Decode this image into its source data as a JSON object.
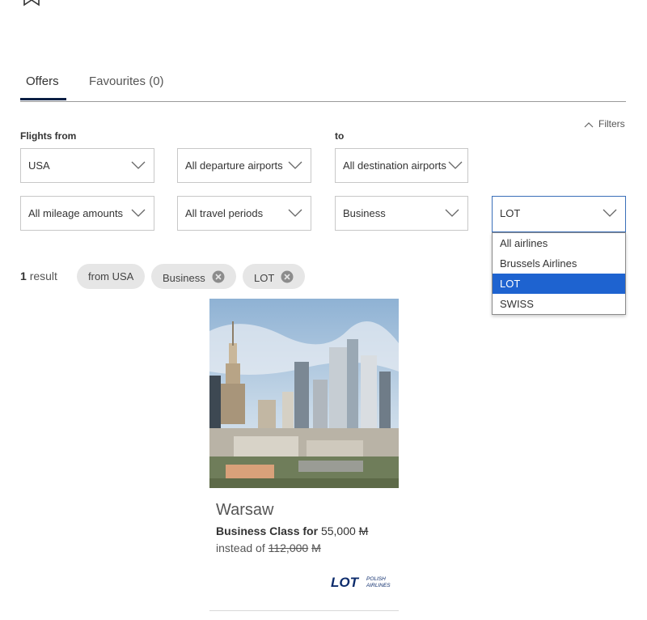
{
  "tabs": {
    "offers": "Offers",
    "favourites": "Favourites (0)"
  },
  "filters_toggle": "Filters",
  "labels": {
    "flights_from": "Flights from",
    "to": "to"
  },
  "selects": {
    "origin": "USA",
    "departure_airports": "All departure airports",
    "destination_airports": "All destination airports",
    "mileage": "All mileage amounts",
    "travel_periods": "All travel periods",
    "cabin": "Business",
    "airline": "LOT"
  },
  "airline_options": [
    "All airlines",
    "Brussels Airlines",
    "LOT",
    "SWISS"
  ],
  "airline_selected_index": 2,
  "results": {
    "count": "1",
    "label": "result"
  },
  "chips": {
    "origin": "from USA",
    "cabin": "Business",
    "airline": "LOT"
  },
  "offer": {
    "city": "Warsaw",
    "price_label": "Business Class for",
    "price": "55,000",
    "currency_symbol": "M",
    "instead_label": "instead of",
    "old_price": "112,000",
    "airline_logo_text": "LOT",
    "airline_logo_sub1": "POLISH",
    "airline_logo_sub2": "AIRLINES"
  },
  "colors": {
    "accent": "#0a1f44",
    "selection": "#1e63d0",
    "chip_bg": "#e6e6e6",
    "lot_blue": "#0d2c6c"
  }
}
